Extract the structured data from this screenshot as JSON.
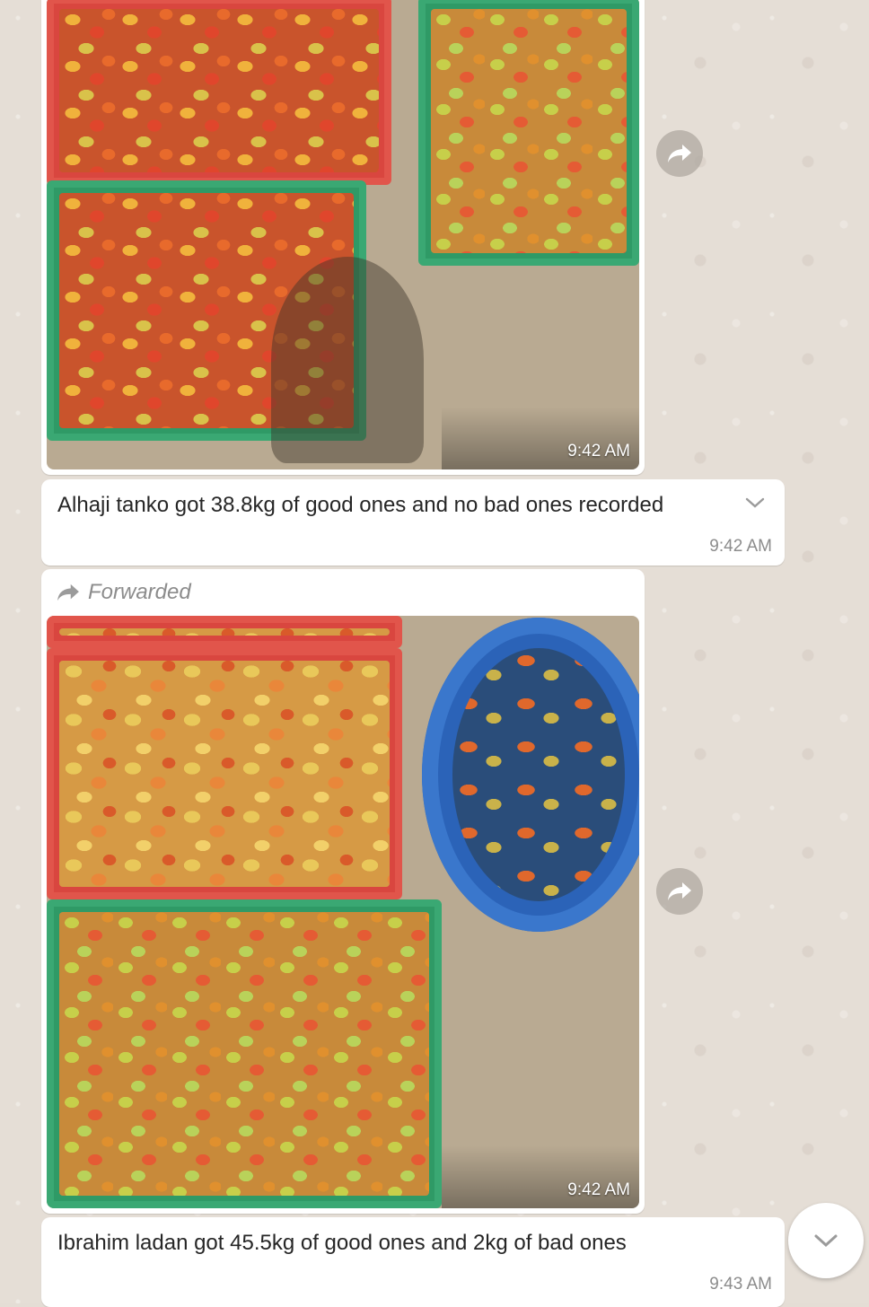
{
  "chat": {
    "messages": [
      {
        "type": "image",
        "image_label": "photo of tomatoes in red and green crates",
        "time": "9:42 AM"
      },
      {
        "type": "text",
        "text": "Alhaji tanko got 38.8kg of good ones and no bad ones recorded",
        "time": "9:42 AM"
      },
      {
        "type": "image",
        "forwarded_label": "Forwarded",
        "image_label": "photo of tomatoes in crates and a blue tub",
        "time": "9:42 AM"
      },
      {
        "type": "text",
        "text": "Ibrahim ladan got 45.5kg of good ones and 2kg of bad ones",
        "time": "9:43 AM"
      }
    ]
  },
  "icons": {
    "forward": "forward-arrow-icon",
    "menu": "chevron-down-icon",
    "scroll": "scroll-down-icon"
  },
  "colors": {
    "bubble": "#ffffff",
    "wallpaper": "#e5ded6",
    "timestamp": "#8c8c8c",
    "text": "#262626"
  }
}
